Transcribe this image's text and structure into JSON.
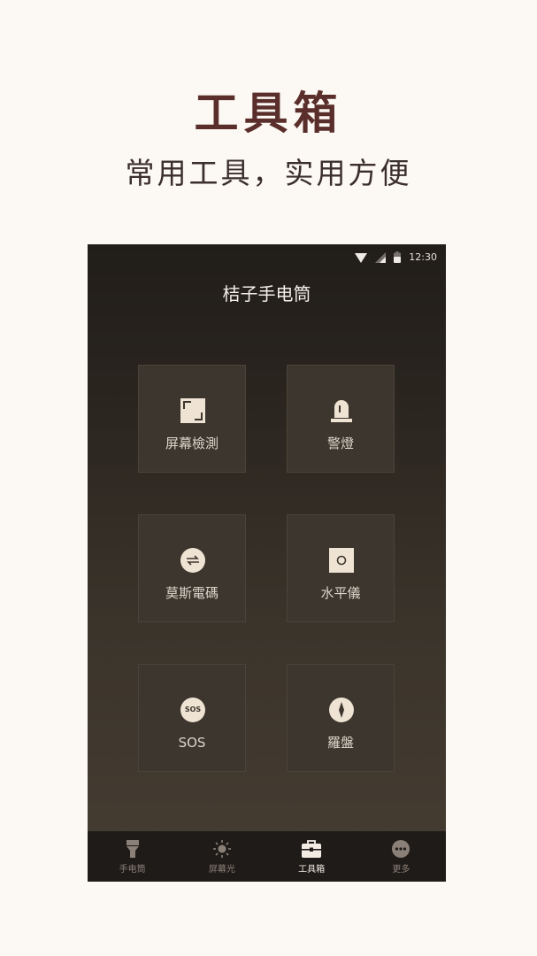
{
  "promo": {
    "title": "工具箱",
    "subtitle": "常用工具，实用方便"
  },
  "status_bar": {
    "time": "12:30",
    "icons": [
      "wifi-icon",
      "signal-icon",
      "battery-icon"
    ]
  },
  "app": {
    "title": "桔子手电筒"
  },
  "tools": [
    {
      "label": "屏幕檢測",
      "icon": "screen-test-icon"
    },
    {
      "label": "警燈",
      "icon": "alarm-light-icon"
    },
    {
      "label": "莫斯電碼",
      "icon": "morse-code-icon"
    },
    {
      "label": "水平儀",
      "icon": "level-icon"
    },
    {
      "label": "SOS",
      "icon": "sos-icon",
      "icon_text": "SOS"
    },
    {
      "label": "羅盤",
      "icon": "compass-icon"
    }
  ],
  "bottom_nav": {
    "items": [
      {
        "label": "手电筒",
        "icon": "flashlight-icon",
        "active": false
      },
      {
        "label": "屏幕光",
        "icon": "sun-icon",
        "active": false
      },
      {
        "label": "工具箱",
        "icon": "toolbox-icon",
        "active": true
      },
      {
        "label": "更多",
        "icon": "more-icon",
        "active": false
      }
    ]
  },
  "colors": {
    "page_background": "#fcf8f3",
    "promo_title": "#5a2e2a",
    "tile_background": "#3d362e",
    "icon_fill": "#efe3d3",
    "nav_background": "#1f1b18"
  }
}
